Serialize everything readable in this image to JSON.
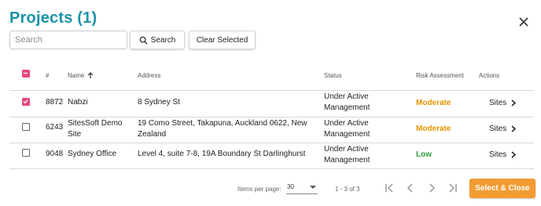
{
  "title": "Projects (1)",
  "search": {
    "placeholder": "Search",
    "value": ""
  },
  "buttons": {
    "search_label": "Search",
    "clear_label": "Clear Selected",
    "select_close_label": "Select & Close"
  },
  "columns": {
    "number": "#",
    "name": "Name",
    "address": "Address",
    "status": "Status",
    "risk": "Risk Assessment",
    "actions": "Actions"
  },
  "rows": [
    {
      "checked": true,
      "number": "8872",
      "name_line1": "Nabzi",
      "name_line2": "",
      "address_line1": "8 Sydney St",
      "address_line2": "",
      "status_line1": "Under Active",
      "status_line2": "Management",
      "risk": "Moderate",
      "risk_color": "#e69500",
      "action": "Sites"
    },
    {
      "checked": false,
      "number": "6243",
      "name_line1": "SitesSoft Demo",
      "name_line2": "Site",
      "address_line1": "19 Como Street, Takapuna, Auckland 0622, New",
      "address_line2": "Zealand",
      "status_line1": "Under Active",
      "status_line2": "Management",
      "risk": "Moderate",
      "risk_color": "#e69500",
      "action": "Sites"
    },
    {
      "checked": false,
      "number": "9048",
      "name_line1": "Sydney Office",
      "name_line2": "",
      "address_line1": "Level 4, suite 7-8, 19A Boundary St Darlinghurst",
      "address_line2": "",
      "status_line1": "Under Active",
      "status_line2": "Management",
      "risk": "Low",
      "risk_color": "#2e9e3e",
      "action": "Sites"
    }
  ],
  "footer": {
    "items_per_page_label": "Items per page:",
    "items_per_page_value": "30",
    "range_label": "1 - 3 of 3"
  },
  "colors": {
    "title": "#1a93a8",
    "checkbox_accent": "#e8477e",
    "primary_button": "#f39c33"
  },
  "icons": {
    "close": "close-icon",
    "search": "search-icon",
    "sort": "arrow-up-icon",
    "chevron": "chevron-right-icon"
  }
}
